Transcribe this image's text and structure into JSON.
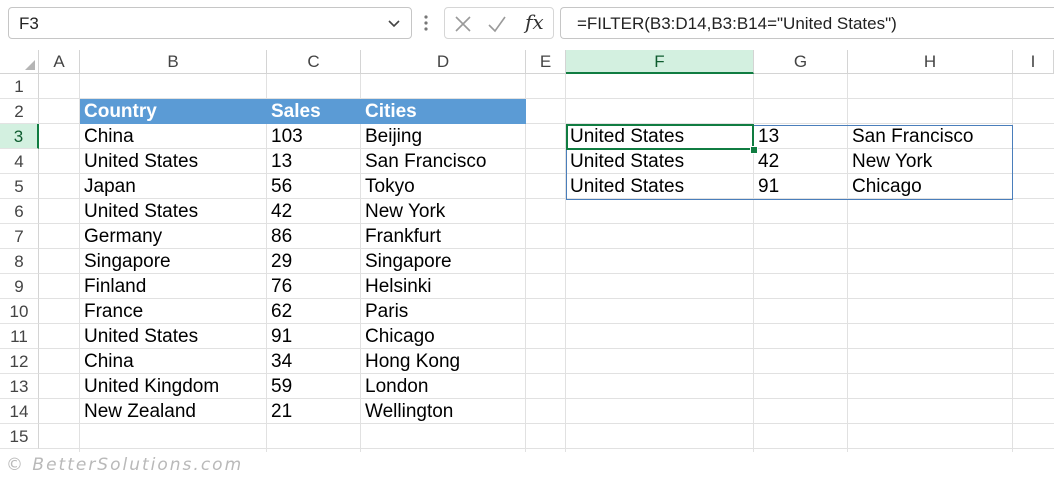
{
  "name_box": {
    "value": "F3"
  },
  "formula_bar": {
    "fx": "fx",
    "formula": "=FILTER(B3:D14,B3:B14=\"United States\")"
  },
  "columns": [
    "A",
    "B",
    "C",
    "D",
    "E",
    "F",
    "G",
    "H",
    "I"
  ],
  "rows": [
    "1",
    "2",
    "3",
    "4",
    "5",
    "6",
    "7",
    "8",
    "9",
    "10",
    "11",
    "12",
    "13",
    "14",
    "15"
  ],
  "table": {
    "headers": [
      "Country",
      "Sales",
      "Cities"
    ],
    "rows": [
      [
        "China",
        "103",
        "Beijing"
      ],
      [
        "United States",
        "13",
        "San Francisco"
      ],
      [
        "Japan",
        "56",
        "Tokyo"
      ],
      [
        "United States",
        "42",
        "New York"
      ],
      [
        "Germany",
        "86",
        "Frankfurt"
      ],
      [
        "Singapore",
        "29",
        "Singapore"
      ],
      [
        "Finland",
        "76",
        "Helsinki"
      ],
      [
        "France",
        "62",
        "Paris"
      ],
      [
        "United States",
        "91",
        "Chicago"
      ],
      [
        "China",
        "34",
        "Hong Kong"
      ],
      [
        "United Kingdom",
        "59",
        "London"
      ],
      [
        "New Zealand",
        "21",
        "Wellington"
      ]
    ]
  },
  "filter_result": [
    [
      "United States",
      "13",
      "San Francisco"
    ],
    [
      "United States",
      "42",
      "New York"
    ],
    [
      "United States",
      "91",
      "Chicago"
    ]
  ],
  "selection": {
    "active_cell": "F3",
    "column": "F",
    "row": "3"
  },
  "colors": {
    "header_fill": "#5b9bd5",
    "selection_green": "#107c41",
    "spill_border": "#4a7ebb"
  },
  "watermark": "© BetterSolutions.com"
}
